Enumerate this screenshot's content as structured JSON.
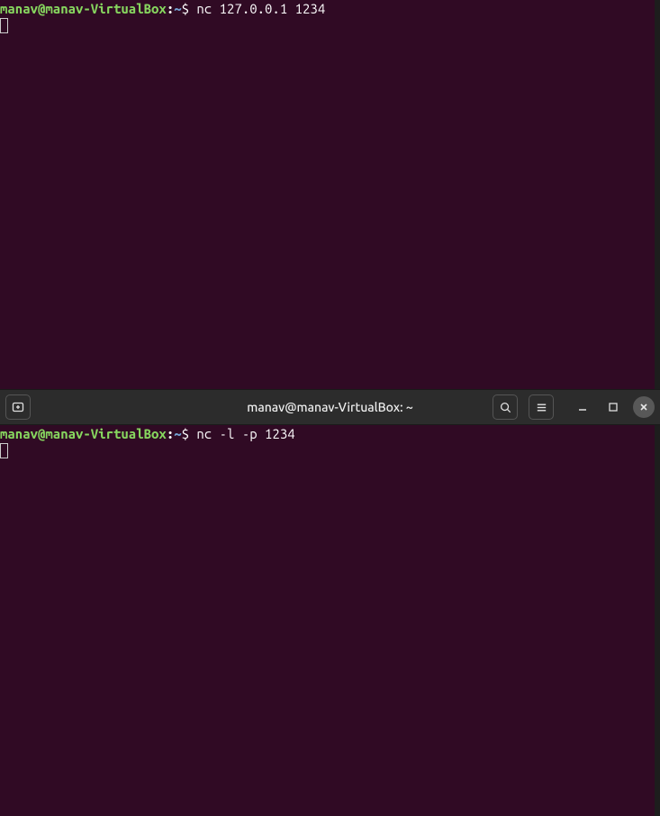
{
  "terminal1": {
    "prompt": {
      "user_host": "manav@manav-VirtualBox",
      "separator": ":",
      "path": "~",
      "symbol": "$"
    },
    "command": " nc 127.0.0.1 1234"
  },
  "titlebar": {
    "title": "manav@manav-VirtualBox: ~",
    "icons": {
      "new_tab": "new-tab-icon",
      "search": "search-icon",
      "menu": "menu-icon",
      "minimize": "minimize-icon",
      "maximize": "maximize-icon",
      "close": "close-icon"
    }
  },
  "terminal2": {
    "prompt": {
      "user_host": "manav@manav-VirtualBox",
      "separator": ":",
      "path": "~",
      "symbol": "$"
    },
    "command": " nc -l -p 1234"
  },
  "colors": {
    "background": "#300a24",
    "titlebar": "#2c2c2c",
    "user_host": "#87d75f",
    "path": "#729fcf",
    "text": "#ffffff"
  }
}
